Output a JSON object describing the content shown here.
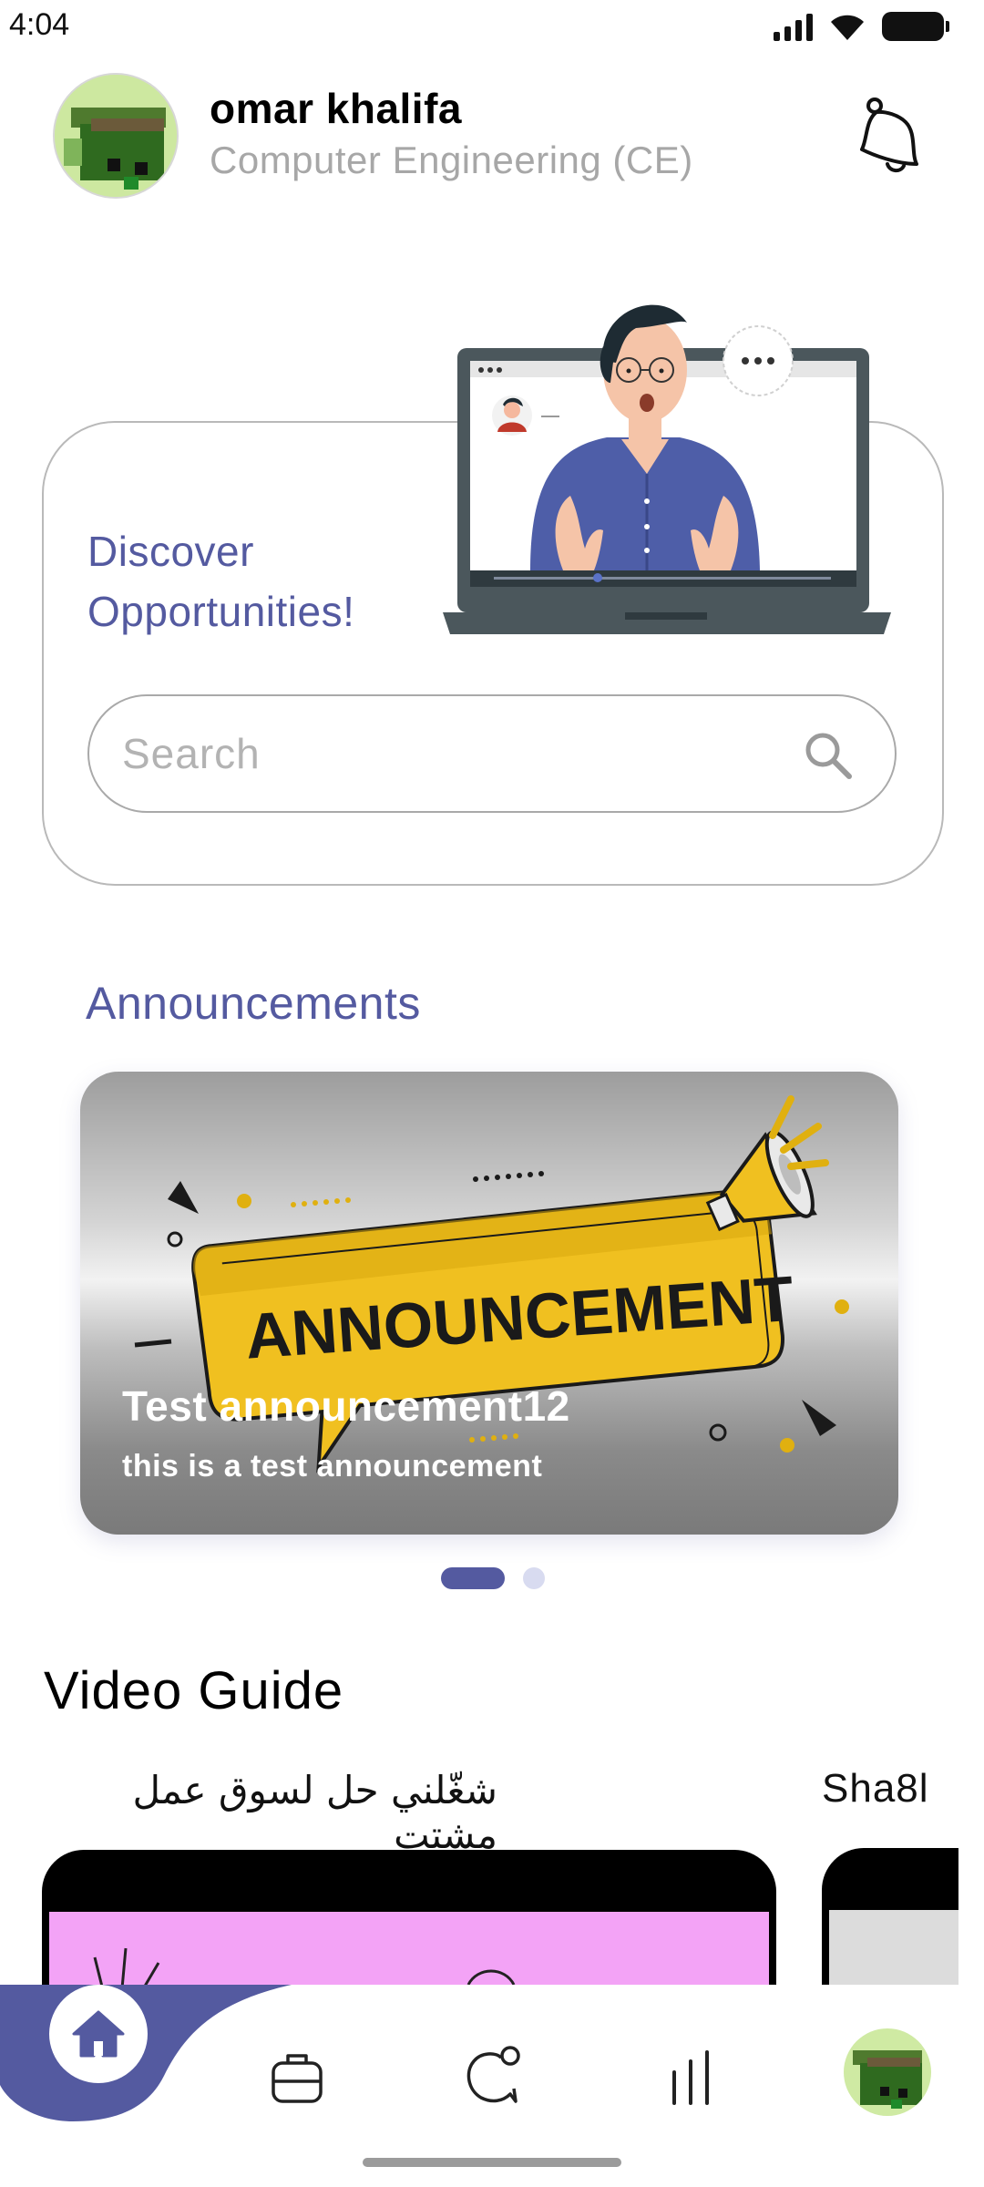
{
  "status_bar": {
    "time": "4:04"
  },
  "header": {
    "name": "omar khalifa",
    "department": "Computer Engineering (CE)"
  },
  "discover": {
    "title": "Discover Opportunities!",
    "search_placeholder": "Search",
    "search_value": ""
  },
  "announcements": {
    "section_title": "Announcements",
    "items": [
      {
        "title": "Test announcement12",
        "subtitle": "this is a test announcement",
        "image_text": "ANNOUNCEMENT"
      }
    ],
    "page_count": 2,
    "active_page": 1
  },
  "video_guide": {
    "section_title": "Video Guide",
    "videos": [
      {
        "caption": "شغّلني حل لسوق عمل مشتت"
      },
      {
        "caption": "Sha8l"
      }
    ]
  },
  "bottom_nav": {
    "items": [
      "home-icon",
      "briefcase-icon",
      "chat-icon",
      "stats-icon",
      "profile-avatar"
    ],
    "active": "home-icon"
  },
  "colors": {
    "accent": "#545aa0",
    "muted_text": "#a7a7a7",
    "border": "#b9b9b9",
    "announcement_yellow": "#f0c020"
  }
}
